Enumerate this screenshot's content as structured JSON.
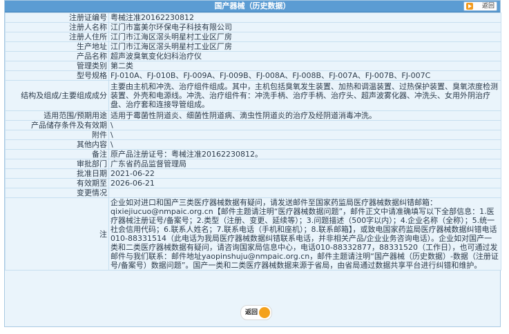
{
  "header": {
    "title": "国产器械（历史数据）",
    "back_label": "返回"
  },
  "fields": [
    {
      "label": "注册证编号",
      "value": "粤械注准20162230812"
    },
    {
      "label": "注册人名称",
      "value": "江门市富美尔环保电子科技有限公司"
    },
    {
      "label": "注册人住所",
      "value": "江门市江海区滘头明星村工业区厂房"
    },
    {
      "label": "生产地址",
      "value": "江门市江海区滘头明星村工业区厂房"
    },
    {
      "label": "产品名称",
      "value": "超声波臭氧变化妇科治疗仪"
    },
    {
      "label": "管理类别",
      "value": "第二类"
    },
    {
      "label": "型号规格",
      "value": "FJ-010A、FJ-010B、FJ-009A、FJ-009B、FJ-008A、FJ-008B、FJ-007A、FJ-007B、FJ-007C"
    },
    {
      "label": "结构及组成/主要组成成分",
      "value": "主要由主机和冲洗、治疗组件组成。其中，主机包括臭氧发生装置、加热和调温装置、过热保护装置、臭氧浓度检测装置、外壳和电源线。冲洗、治疗组件有：冲洗手柄、治疗手柄、治疗头、超声波雾化器、冲洗头、女用外阴治疗盘、治疗套和连接导管组成。"
    },
    {
      "label": "适用范围/预期用途",
      "value": "适用于霉菌性阴道炎、细菌性阴道病、滴虫性阴道炎的治疗及经阴道消毒冲洗。"
    },
    {
      "label": "产品储存条件及有效期",
      "value": "\\"
    },
    {
      "label": "附件",
      "value": "\\"
    },
    {
      "label": "其他内容",
      "value": "\\"
    },
    {
      "label": "备注",
      "value": "原产品注册证号：粤械注准20162230812。"
    },
    {
      "label": "审批部门",
      "value": "广东省药品监督管理局"
    },
    {
      "label": "批准日期",
      "value": "2021-06-22"
    },
    {
      "label": "有效期至",
      "value": "2026-06-21"
    },
    {
      "label": "变更情况",
      "value": ""
    }
  ],
  "note": {
    "label": "注",
    "text": "企业如对进口和国产三类医疗器械数据有疑问，请发送邮件至国家药监局医疗器械数据纠错邮箱：qixiejiucuo@nmpaic.org.cn【邮件主题请注明“医疗器械数据问题”，邮件正文中请准确填写以下全部信息：1.医疗器械注册证号/备案号；2.类型（注册、变更、延续等）；3.问题描述（500字以内）；4.企业名称（全称）；5.统一社会信用代码；6.联系人姓名；7.联系电话（手机和座机）；8.联系邮箱】，或致电国家药监局医疗器械数据纠错电话010-88331514（此电话为我局医疗器械数据纠错联系电话，并非相关产品/企业业务咨询电话）。企业如对国产一类和二类医疗器械数据有疑问，请咨询国家局信息中心，电话010-88332877，88331520（工作日），也可通过发邮件与我们联系：邮件地址yaopinshuju@nmpaic.org.cn，邮件主题请注明“国产器械（历史数据）-数据（注册证号/备案号）数据问题”。国产一类和二类医疗器械数据来源于省局，由省局通过数据共享平台进行纠错和维护。"
  },
  "footer": {
    "back_label": "返回"
  },
  "colors": {
    "titlebar": "#5b9cd3",
    "background": "#eaf4fb",
    "border": "#c7dff0",
    "accent": "#f4a11d"
  }
}
